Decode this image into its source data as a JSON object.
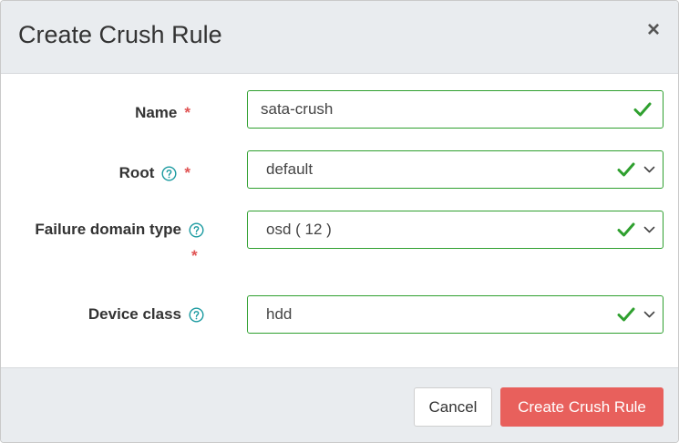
{
  "dialog": {
    "title": "Create Crush Rule",
    "close_glyph": "×"
  },
  "form": {
    "name": {
      "label": "Name",
      "required_mark": "*",
      "value": "sata-crush",
      "valid": true
    },
    "root": {
      "label": "Root",
      "required_mark": "*",
      "value": "default",
      "valid": true,
      "has_help": true
    },
    "failure_domain": {
      "label": "Failure domain type",
      "required_mark": "*",
      "value": "osd ( 12 )",
      "valid": true,
      "has_help": true
    },
    "device_class": {
      "label": "Device class",
      "value": "hdd",
      "valid": true,
      "has_help": true
    }
  },
  "footer": {
    "cancel_label": "Cancel",
    "submit_label": "Create Crush Rule"
  },
  "colors": {
    "valid_green": "#2fa02f",
    "required_red": "#e05353",
    "help_teal": "#1a9aa0",
    "submit_bg": "#e8605c"
  },
  "icons": [
    "close-icon",
    "help-icon",
    "check-icon",
    "chevron-down-icon"
  ]
}
